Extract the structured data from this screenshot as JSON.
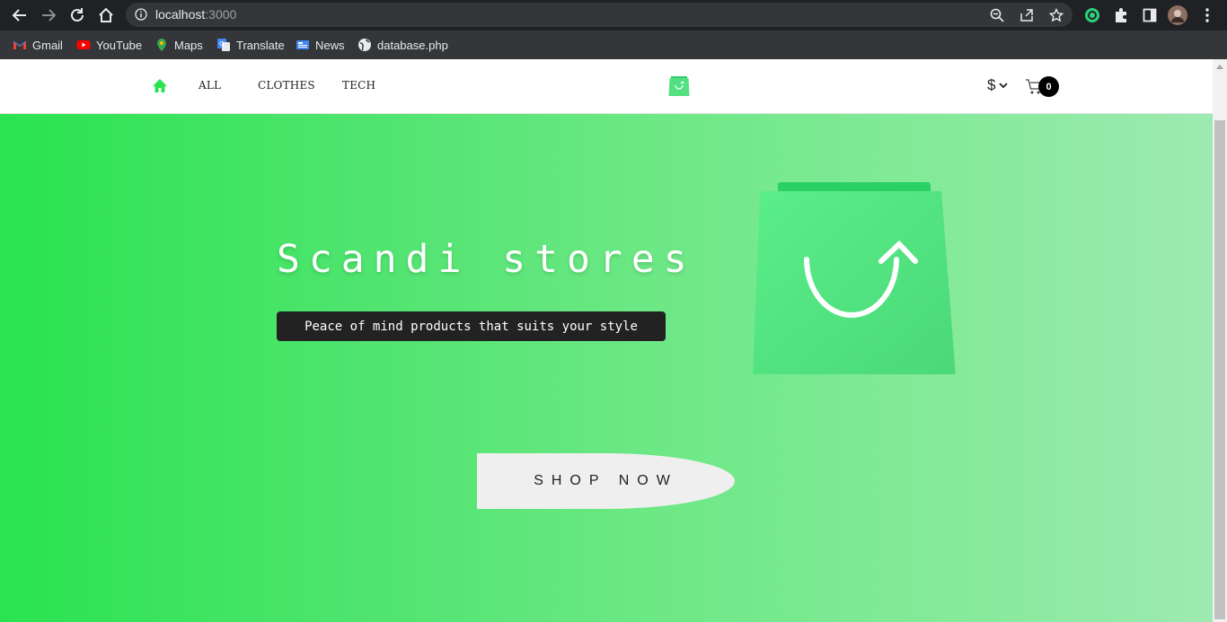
{
  "browser": {
    "url_host": "localhost",
    "url_port": ":3000",
    "bookmarks": [
      {
        "label": "Gmail",
        "icon": "gmail-icon"
      },
      {
        "label": "YouTube",
        "icon": "youtube-icon"
      },
      {
        "label": "Maps",
        "icon": "maps-icon"
      },
      {
        "label": "Translate",
        "icon": "translate-icon"
      },
      {
        "label": "News",
        "icon": "news-icon"
      },
      {
        "label": "database.php",
        "icon": "globe-icon"
      }
    ]
  },
  "header": {
    "nav": [
      {
        "label": "ALL"
      },
      {
        "label": "CLOTHES"
      },
      {
        "label": "TECH"
      }
    ],
    "currency_symbol": "$",
    "cart_count": "0",
    "accent_color": "#2ae34f"
  },
  "hero": {
    "title": "Scandi stores",
    "tagline": "Peace of mind products that suits your style",
    "cta_label": "SHOP NOW"
  }
}
